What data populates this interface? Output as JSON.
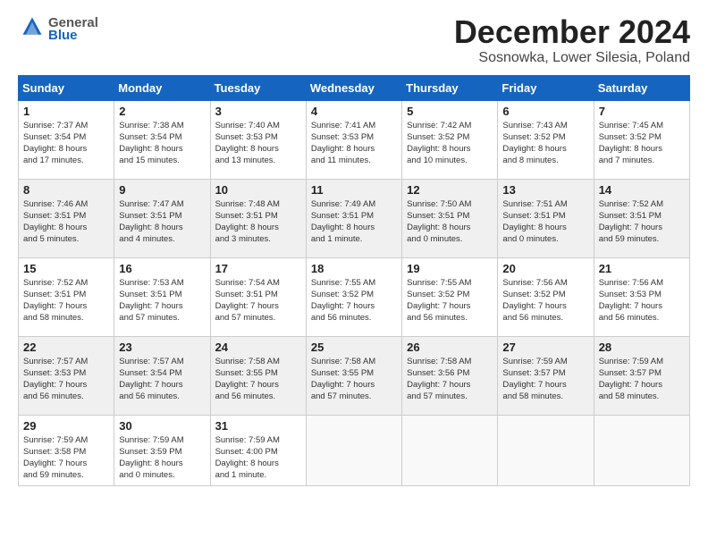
{
  "header": {
    "logo_general": "General",
    "logo_blue": "Blue",
    "month_title": "December 2024",
    "location": "Sosnowka, Lower Silesia, Poland"
  },
  "days_of_week": [
    "Sunday",
    "Monday",
    "Tuesday",
    "Wednesday",
    "Thursday",
    "Friday",
    "Saturday"
  ],
  "weeks": [
    [
      {
        "day": "1",
        "info": "Sunrise: 7:37 AM\nSunset: 3:54 PM\nDaylight: 8 hours\nand 17 minutes."
      },
      {
        "day": "2",
        "info": "Sunrise: 7:38 AM\nSunset: 3:54 PM\nDaylight: 8 hours\nand 15 minutes."
      },
      {
        "day": "3",
        "info": "Sunrise: 7:40 AM\nSunset: 3:53 PM\nDaylight: 8 hours\nand 13 minutes."
      },
      {
        "day": "4",
        "info": "Sunrise: 7:41 AM\nSunset: 3:53 PM\nDaylight: 8 hours\nand 11 minutes."
      },
      {
        "day": "5",
        "info": "Sunrise: 7:42 AM\nSunset: 3:52 PM\nDaylight: 8 hours\nand 10 minutes."
      },
      {
        "day": "6",
        "info": "Sunrise: 7:43 AM\nSunset: 3:52 PM\nDaylight: 8 hours\nand 8 minutes."
      },
      {
        "day": "7",
        "info": "Sunrise: 7:45 AM\nSunset: 3:52 PM\nDaylight: 8 hours\nand 7 minutes."
      }
    ],
    [
      {
        "day": "8",
        "info": "Sunrise: 7:46 AM\nSunset: 3:51 PM\nDaylight: 8 hours\nand 5 minutes."
      },
      {
        "day": "9",
        "info": "Sunrise: 7:47 AM\nSunset: 3:51 PM\nDaylight: 8 hours\nand 4 minutes."
      },
      {
        "day": "10",
        "info": "Sunrise: 7:48 AM\nSunset: 3:51 PM\nDaylight: 8 hours\nand 3 minutes."
      },
      {
        "day": "11",
        "info": "Sunrise: 7:49 AM\nSunset: 3:51 PM\nDaylight: 8 hours\nand 1 minute."
      },
      {
        "day": "12",
        "info": "Sunrise: 7:50 AM\nSunset: 3:51 PM\nDaylight: 8 hours\nand 0 minutes."
      },
      {
        "day": "13",
        "info": "Sunrise: 7:51 AM\nSunset: 3:51 PM\nDaylight: 8 hours\nand 0 minutes."
      },
      {
        "day": "14",
        "info": "Sunrise: 7:52 AM\nSunset: 3:51 PM\nDaylight: 7 hours\nand 59 minutes."
      }
    ],
    [
      {
        "day": "15",
        "info": "Sunrise: 7:52 AM\nSunset: 3:51 PM\nDaylight: 7 hours\nand 58 minutes."
      },
      {
        "day": "16",
        "info": "Sunrise: 7:53 AM\nSunset: 3:51 PM\nDaylight: 7 hours\nand 57 minutes."
      },
      {
        "day": "17",
        "info": "Sunrise: 7:54 AM\nSunset: 3:51 PM\nDaylight: 7 hours\nand 57 minutes."
      },
      {
        "day": "18",
        "info": "Sunrise: 7:55 AM\nSunset: 3:52 PM\nDaylight: 7 hours\nand 56 minutes."
      },
      {
        "day": "19",
        "info": "Sunrise: 7:55 AM\nSunset: 3:52 PM\nDaylight: 7 hours\nand 56 minutes."
      },
      {
        "day": "20",
        "info": "Sunrise: 7:56 AM\nSunset: 3:52 PM\nDaylight: 7 hours\nand 56 minutes."
      },
      {
        "day": "21",
        "info": "Sunrise: 7:56 AM\nSunset: 3:53 PM\nDaylight: 7 hours\nand 56 minutes."
      }
    ],
    [
      {
        "day": "22",
        "info": "Sunrise: 7:57 AM\nSunset: 3:53 PM\nDaylight: 7 hours\nand 56 minutes."
      },
      {
        "day": "23",
        "info": "Sunrise: 7:57 AM\nSunset: 3:54 PM\nDaylight: 7 hours\nand 56 minutes."
      },
      {
        "day": "24",
        "info": "Sunrise: 7:58 AM\nSunset: 3:55 PM\nDaylight: 7 hours\nand 56 minutes."
      },
      {
        "day": "25",
        "info": "Sunrise: 7:58 AM\nSunset: 3:55 PM\nDaylight: 7 hours\nand 57 minutes."
      },
      {
        "day": "26",
        "info": "Sunrise: 7:58 AM\nSunset: 3:56 PM\nDaylight: 7 hours\nand 57 minutes."
      },
      {
        "day": "27",
        "info": "Sunrise: 7:59 AM\nSunset: 3:57 PM\nDaylight: 7 hours\nand 58 minutes."
      },
      {
        "day": "28",
        "info": "Sunrise: 7:59 AM\nSunset: 3:57 PM\nDaylight: 7 hours\nand 58 minutes."
      }
    ],
    [
      {
        "day": "29",
        "info": "Sunrise: 7:59 AM\nSunset: 3:58 PM\nDaylight: 7 hours\nand 59 minutes."
      },
      {
        "day": "30",
        "info": "Sunrise: 7:59 AM\nSunset: 3:59 PM\nDaylight: 8 hours\nand 0 minutes."
      },
      {
        "day": "31",
        "info": "Sunrise: 7:59 AM\nSunset: 4:00 PM\nDaylight: 8 hours\nand 1 minute."
      },
      {
        "day": "",
        "info": ""
      },
      {
        "day": "",
        "info": ""
      },
      {
        "day": "",
        "info": ""
      },
      {
        "day": "",
        "info": ""
      }
    ]
  ]
}
